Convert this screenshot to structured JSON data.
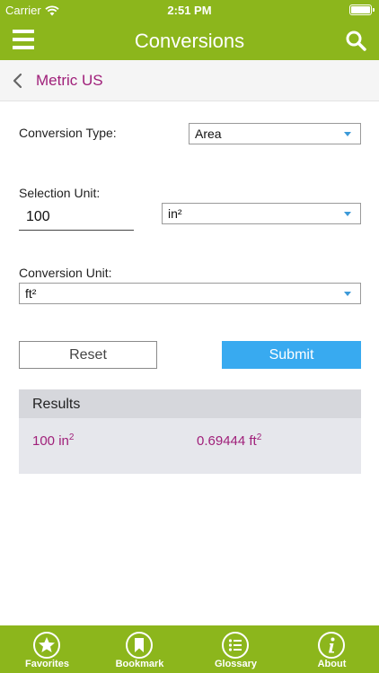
{
  "status_bar": {
    "carrier": "Carrier",
    "time": "2:51 PM"
  },
  "header": {
    "title": "Conversions"
  },
  "sub_header": {
    "title": "Metric US"
  },
  "form": {
    "conversion_type_label": "Conversion Type:",
    "conversion_type_value": "Area",
    "selection_unit_label": "Selection Unit:",
    "selection_value": "100",
    "selection_unit_value": "in²",
    "conversion_unit_label": "Conversion Unit:",
    "conversion_unit_value": "ft²",
    "reset_label": "Reset",
    "submit_label": "Submit"
  },
  "results": {
    "header": "Results",
    "input_value": "100 in",
    "input_exponent": "2",
    "output_value": "0.69444 ft",
    "output_exponent": "2"
  },
  "tabs": [
    {
      "label": "Favorites",
      "icon": "star-icon"
    },
    {
      "label": "Bookmark",
      "icon": "bookmark-icon"
    },
    {
      "label": "Glossary",
      "icon": "list-icon"
    },
    {
      "label": "About",
      "icon": "info-icon"
    }
  ],
  "colors": {
    "brand_green": "#8cb61c",
    "accent_magenta": "#a0207a",
    "submit_blue": "#38aaf0"
  }
}
